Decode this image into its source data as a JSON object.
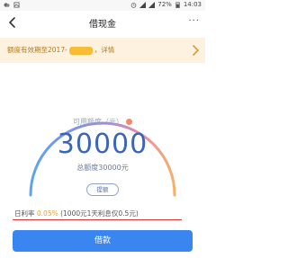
{
  "status_bar": {
    "signal": "100%",
    "battery": "72%",
    "time": "14:03"
  },
  "nav": {
    "title": "借现金",
    "more": "···"
  },
  "notice": {
    "prefix": "额度有效期至2017-",
    "suffix": "，详情"
  },
  "credit": {
    "available_label": "可用额度（元）",
    "available_amount": "30000",
    "total_label": "总额度30000元",
    "raise_label": "提额"
  },
  "rate": {
    "label": "日利率",
    "value": "0.05%",
    "detail": "(1000元1天利息仅0.5元)"
  },
  "borrow": {
    "label": "借款"
  },
  "colors": {
    "primary": "#3a86f0",
    "amount": "#3b66b8",
    "notice_bg": "#fdf2df",
    "rate_value": "#e8a23a",
    "underline": "#e03131"
  }
}
